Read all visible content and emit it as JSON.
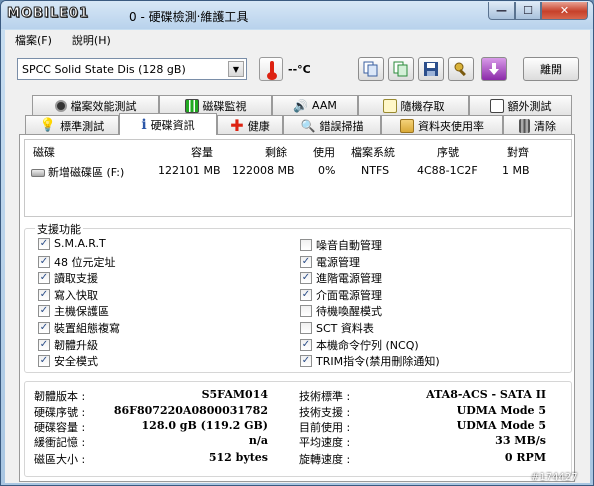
{
  "window": {
    "logo_text": "MOBILE01",
    "title": "0 - 硬碟檢測‧維護工具",
    "min_glyph": "—",
    "max_glyph": "☐",
    "close_glyph": "✕"
  },
  "menu": {
    "items": [
      {
        "label": "檔案(F)"
      },
      {
        "label": "說明(H)"
      }
    ]
  },
  "toolbar": {
    "drive_value": "SPCC Solid State Dis    (128 gB)",
    "temperature": "--°C",
    "exit_label": "離開"
  },
  "tabs": {
    "row1": [
      {
        "label": "檔案效能測試"
      },
      {
        "label": "磁碟監視"
      },
      {
        "label": "AAM"
      },
      {
        "label": "隨機存取"
      },
      {
        "label": "額外測試"
      }
    ],
    "row2": [
      {
        "label": "標準測試"
      },
      {
        "label": "硬碟資訊"
      },
      {
        "label": "健康"
      },
      {
        "label": "錯誤掃描"
      },
      {
        "label": "資料夾使用率"
      },
      {
        "label": "清除"
      }
    ]
  },
  "partitions": {
    "headers": [
      "磁碟",
      "容量",
      "剩餘",
      "使用",
      "檔案系統",
      "序號",
      "對齊"
    ],
    "rows": [
      {
        "disk": "新增磁碟區 (F:)",
        "capacity": "122101 MB",
        "free": "122008 MB",
        "used": "0%",
        "fs": "NTFS",
        "serial": "4C88-1C2F",
        "align": "1 MB"
      }
    ]
  },
  "features": {
    "title": "支援功能",
    "left": [
      {
        "label": "S.M.A.R.T",
        "checked": true
      },
      {
        "label": "48 位元定址",
        "checked": true
      },
      {
        "label": "讀取支援",
        "checked": true
      },
      {
        "label": "寫入快取",
        "checked": true
      },
      {
        "label": "主機保護區",
        "checked": true
      },
      {
        "label": "裝置組態複寫",
        "checked": true
      },
      {
        "label": "韌體升級",
        "checked": true
      },
      {
        "label": "安全模式",
        "checked": true
      }
    ],
    "right": [
      {
        "label": "噪音自動管理",
        "checked": false
      },
      {
        "label": "電源管理",
        "checked": true
      },
      {
        "label": "進階電源管理",
        "checked": true
      },
      {
        "label": "介面電源管理",
        "checked": true
      },
      {
        "label": "待機喚醒模式",
        "checked": false
      },
      {
        "label": "SCT 資料表",
        "checked": false
      },
      {
        "label": "本機命令佇列 (NCQ)",
        "checked": true
      },
      {
        "label": "TRIM指令(禁用刪除通知)",
        "checked": true
      }
    ]
  },
  "info": {
    "left": [
      {
        "label": "韌體版本 :",
        "value": "S5FAM014"
      },
      {
        "label": "硬碟序號 :",
        "value": "86F807220A0800031782"
      },
      {
        "label": "硬碟容量 :",
        "value": "128.0 gB (119.2 GB)"
      },
      {
        "label": "緩衝記憶 :",
        "value": "n/a"
      },
      {
        "label": "磁區大小 :",
        "value": "512 bytes"
      }
    ],
    "right": [
      {
        "label": "技術標準 :",
        "value": "ATA8-ACS - SATA II"
      },
      {
        "label": "技術支援 :",
        "value": "UDMA Mode 5"
      },
      {
        "label": "目前使用 :",
        "value": "UDMA Mode 5"
      },
      {
        "label": "平均速度 :",
        "value": "33 MB/s"
      },
      {
        "label": "旋轉速度 :",
        "value": "0 RPM"
      }
    ]
  },
  "watermark": "#174427"
}
